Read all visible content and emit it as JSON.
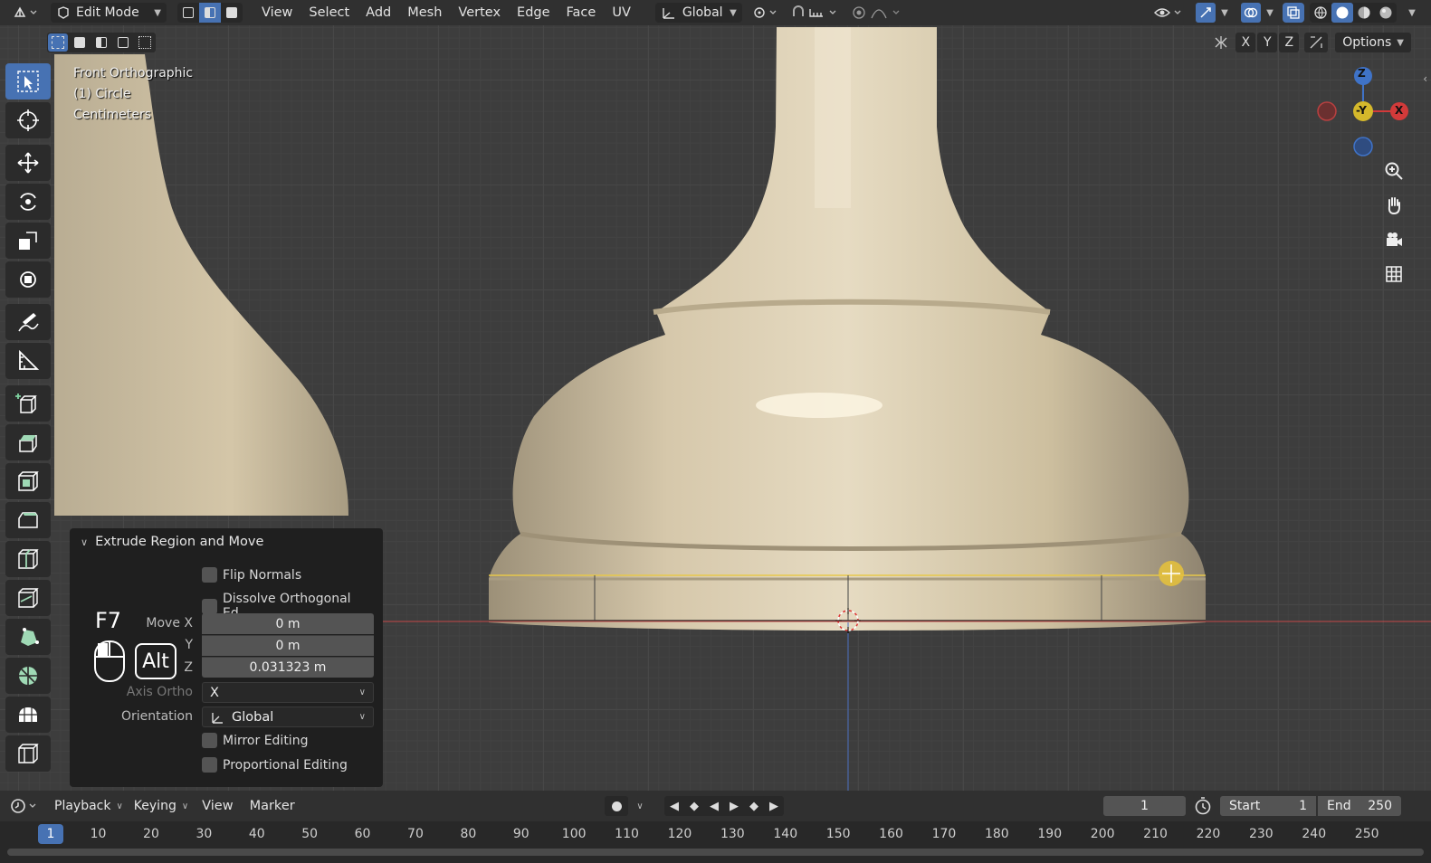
{
  "header": {
    "editor_icon": "mesh-cube-icon",
    "mode_label": "Edit Mode",
    "menus": [
      "View",
      "Select",
      "Add",
      "Mesh",
      "Vertex",
      "Edge",
      "Face",
      "UV"
    ],
    "orientation_label": "Global"
  },
  "viewport": {
    "view_name": "Front Orthographic",
    "object_label": "(1) Circle",
    "units": "Centimeters",
    "axis_buttons": [
      "X",
      "Y",
      "Z"
    ],
    "options_label": "Options",
    "gizmo": {
      "z": "Z",
      "y": "-Y",
      "x": "X"
    }
  },
  "operator_panel": {
    "title": "Extrude Region and Move",
    "flip_normals": "Flip Normals",
    "dissolve": "Dissolve Orthogonal Ed...",
    "move_x_label": "Move X",
    "y_label": "Y",
    "z_label": "Z",
    "move_x": "0 m",
    "move_y": "0 m",
    "move_z": "0.031323 m",
    "axis_ortho_label": "Axis Ortho",
    "axis_ortho": "X",
    "orientation_label": "Orientation",
    "orientation": "Global",
    "mirror_editing": "Mirror Editing",
    "proportional_editing": "Proportional Editing"
  },
  "key_overlay": {
    "key1": "F7",
    "key2": "Alt"
  },
  "timeline": {
    "menus": [
      "Playback",
      "Keying",
      "View",
      "Marker"
    ],
    "current_frame": "1",
    "start_label": "Start",
    "start": "1",
    "end_label": "End",
    "end": "250",
    "ruler_current": "1",
    "ruler_ticks": [
      "10",
      "20",
      "30",
      "40",
      "50",
      "60",
      "70",
      "80",
      "90",
      "100",
      "110",
      "120",
      "130",
      "140",
      "150",
      "160",
      "170",
      "180",
      "190",
      "200",
      "210",
      "220",
      "230",
      "240",
      "250"
    ]
  },
  "colors": {
    "accent": "#4772b3",
    "mesh": "#d9cbb0",
    "axis_x": "#d23a3a",
    "axis_y": "#d4b82b",
    "axis_z": "#3f73c8"
  }
}
